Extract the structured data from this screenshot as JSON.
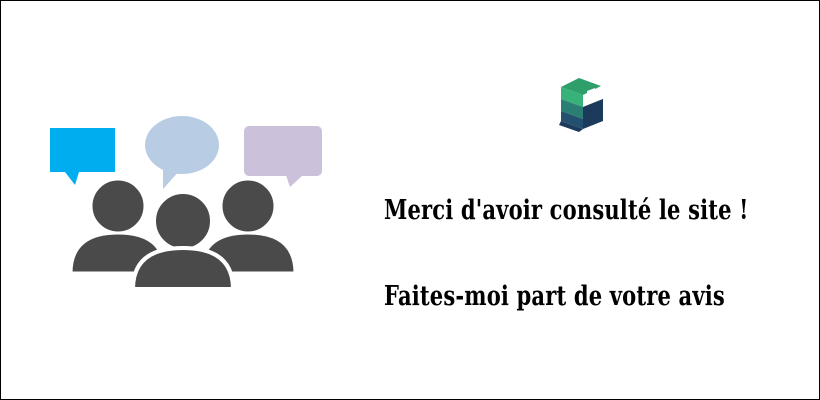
{
  "banner": {
    "line1": "Merci d'avoir consulté le site !",
    "line2": "Faites-moi part de votre avis"
  },
  "colors": {
    "bubble_left": "#00aeef",
    "bubble_center": "#b8cce4",
    "bubble_right": "#ccc1da",
    "person": "#4a4a4a",
    "logo_green": "#2e9e6a",
    "logo_navy": "#1b3a5c",
    "text": "#000000"
  },
  "icons": {
    "illustration": "people-feedback-icon",
    "logo": "site-logo-icon"
  }
}
